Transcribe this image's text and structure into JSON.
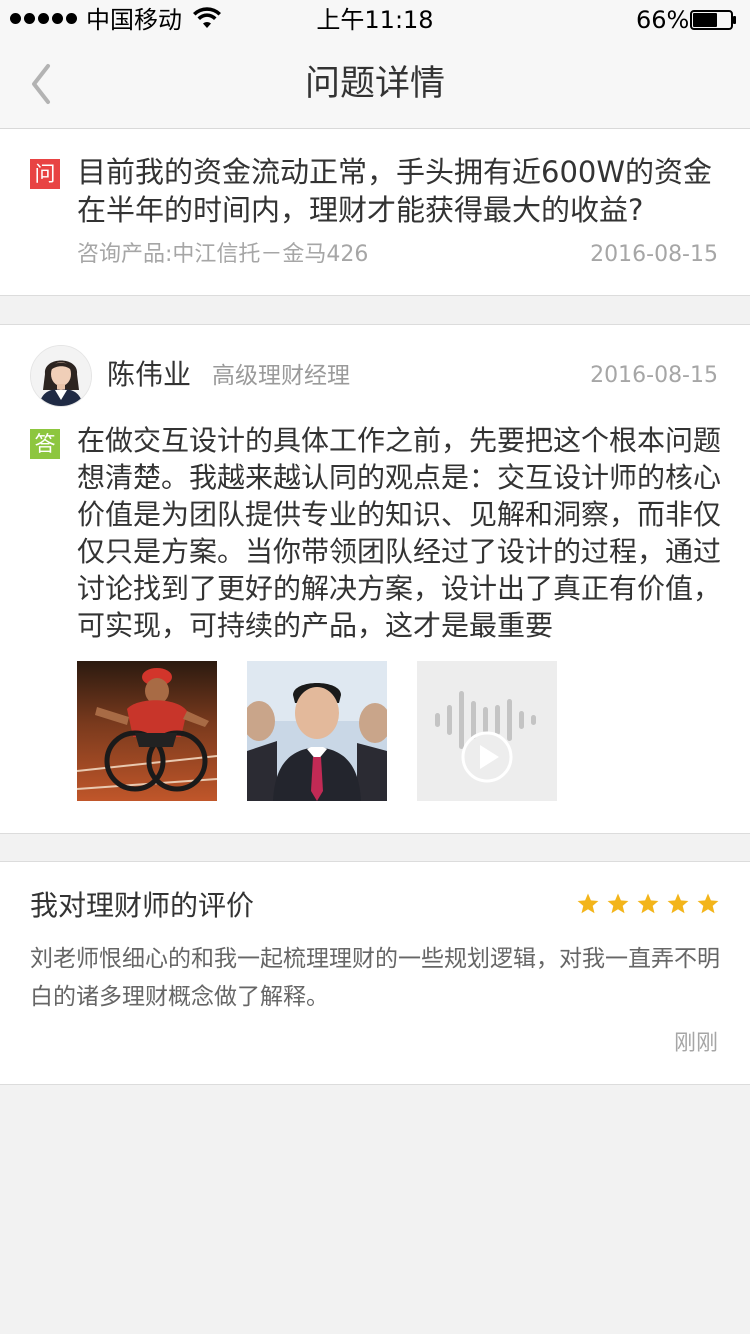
{
  "status_bar": {
    "carrier": "中国移动",
    "time": "上午11:18",
    "battery_percent": "66%",
    "battery_level": 0.66,
    "signal_bars": 5
  },
  "nav": {
    "title": "问题详情",
    "back_icon": "chevron-left-icon"
  },
  "question": {
    "badge": "问",
    "text": "目前我的资金流动正常，手头拥有近600W的资金在半年的时间内，理财才能获得最大的收益?",
    "product": "咨询产品:中江信托－金马426",
    "date": "2016-08-15"
  },
  "answer": {
    "advisor_name": "陈伟业",
    "advisor_title": "高级理财经理",
    "date": "2016-08-15",
    "badge": "答",
    "text": "在做交互设计的具体工作之前，先要把这个根本问题想清楚。我越来越认同的观点是：交互设计师的核心价值是为团队提供专业的知识、见解和洞察，而非仅仅只是方案。当你带领团队经过了设计的过程，通过讨论找到了更好的解决方案，设计出了真正有价值，可实现，可持续的产品，这才是最重要",
    "attachments": [
      {
        "type": "image",
        "icon": "photo-athlete"
      },
      {
        "type": "image",
        "icon": "photo-portrait"
      },
      {
        "type": "audio",
        "icon": "play-icon"
      }
    ]
  },
  "review": {
    "title": "我对理财师的评价",
    "rating": 5,
    "rating_max": 5,
    "text": "刘老师恨细心的和我一起梳理理财的一些规划逻辑，对我一直弄不明白的诸多理财概念做了解释。",
    "time": "刚刚"
  },
  "colors": {
    "question_badge": "#e84343",
    "answer_badge": "#8dc63f",
    "star": "#f3b51b",
    "background": "#f2f2f2"
  }
}
